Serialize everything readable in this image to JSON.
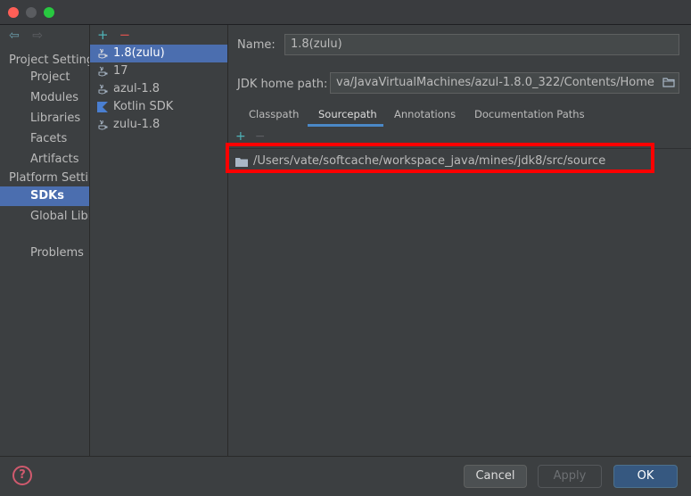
{
  "nav": {
    "project_settings_header": "Project Setting",
    "platform_settings_header": "Platform Settin",
    "items": [
      {
        "label": "Project"
      },
      {
        "label": "Modules"
      },
      {
        "label": "Libraries"
      },
      {
        "label": "Facets"
      },
      {
        "label": "Artifacts"
      },
      {
        "label": "SDKs"
      },
      {
        "label": "Global Libr"
      },
      {
        "label": "Problems"
      }
    ]
  },
  "sdk_list": {
    "add_label": "+",
    "remove_label": "−",
    "items": [
      {
        "label": "1.8(zulu)",
        "icon": "java-icon"
      },
      {
        "label": "17",
        "icon": "java-icon"
      },
      {
        "label": "azul-1.8",
        "icon": "java-icon"
      },
      {
        "label": "Kotlin SDK",
        "icon": "kotlin-icon"
      },
      {
        "label": "zulu-1.8",
        "icon": "java-icon"
      }
    ]
  },
  "details": {
    "name_label": "Name:",
    "name_value": "1.8(zulu)",
    "home_label": "JDK home path:",
    "home_value": "va/JavaVirtualMachines/azul-1.8.0_322/Contents/Home",
    "tabs": [
      {
        "label": "Classpath"
      },
      {
        "label": "Sourcepath"
      },
      {
        "label": "Annotations"
      },
      {
        "label": "Documentation Paths"
      }
    ],
    "path_add": "+",
    "path_remove": "−",
    "paths": [
      {
        "value": "/Users/vate/softcache/workspace_java/mines/jdk8/src/source"
      }
    ]
  },
  "footer": {
    "help_label": "?",
    "cancel_label": "Cancel",
    "apply_label": "Apply",
    "ok_label": "OK"
  },
  "colors": {
    "selection": "#4b6eaf",
    "highlight_box": "#ff0000",
    "accent": "#4fb3b8"
  }
}
